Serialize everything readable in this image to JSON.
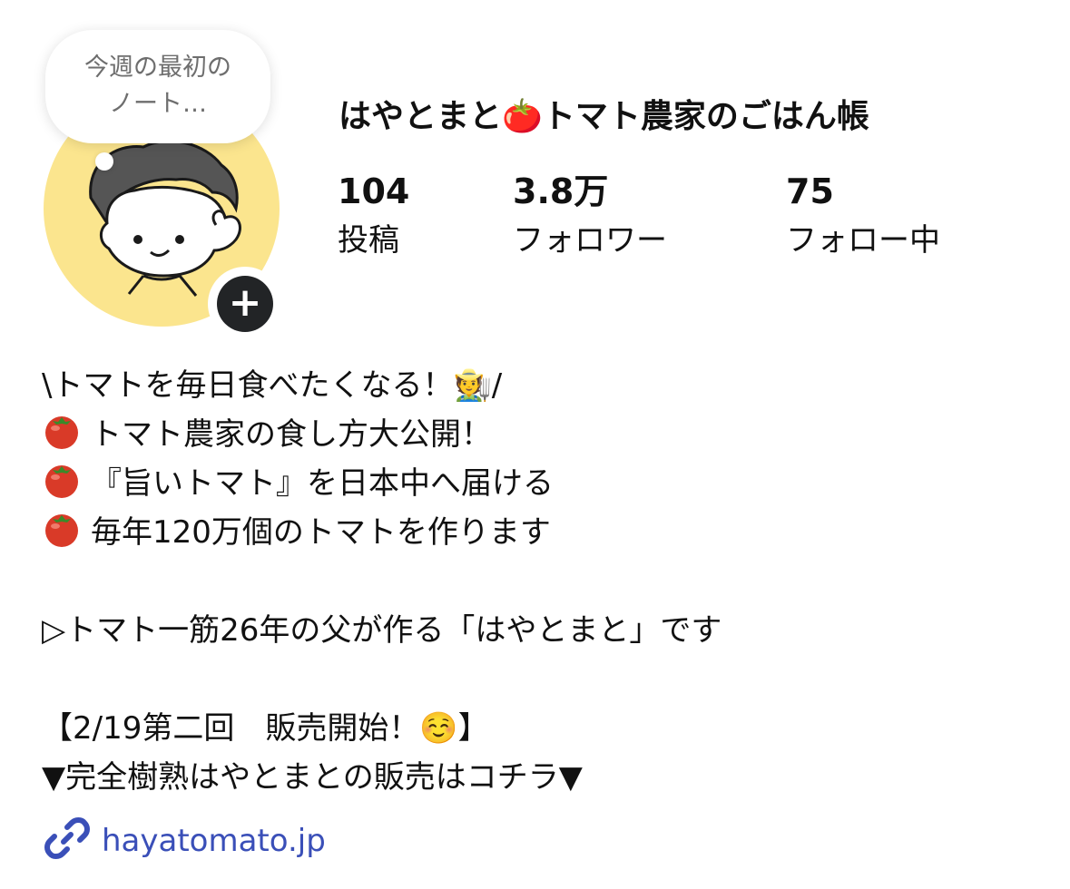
{
  "note": {
    "text_line1": "今週の最初の",
    "text_line2": "ノート…"
  },
  "profile": {
    "name": "はやとまと🍅トマト農家のごはん帳",
    "stats": [
      {
        "value": "104",
        "label": "投稿"
      },
      {
        "value": "3.8万",
        "label": "フォロワー"
      },
      {
        "value": "75",
        "label": "フォロー中"
      }
    ]
  },
  "bio": {
    "line1": "\\トマトを毎日食べたくなる！🧑‍🌾/",
    "line2": "トマト農家の食し方大公開！",
    "line3": "『旨いトマト』を日本中へ届ける",
    "line4": "毎年120万個のトマトを作ります",
    "line5": "▷トマト一筋26年の父が作る「はやとまと」です",
    "line6": "【2/19第二回　販売開始！☺️】",
    "line7": "▼完全樹熟はやとまとの販売はコチラ▼"
  },
  "link": {
    "url": "hayatomato.jp"
  },
  "icons": {
    "add": "plus-icon",
    "link": "link-icon",
    "tomato": "tomato-icon",
    "avatar": "illustrated-face-avatar"
  },
  "colors": {
    "avatar_bg": "#fbe58e",
    "link": "#3a4fb8",
    "add_button": "#222426",
    "tomato": "#d93a28"
  },
  "add_button_label": "+"
}
